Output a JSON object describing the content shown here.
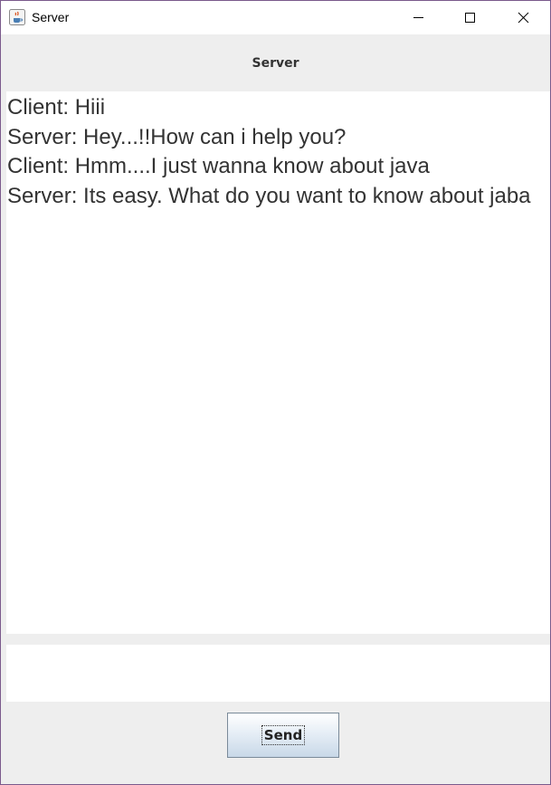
{
  "window": {
    "title": "Server",
    "icon": "java-cup-icon"
  },
  "header": {
    "title": "Server"
  },
  "chat": {
    "messages": [
      "Client: Hiii",
      "Server: Hey...!!How can i help you?",
      "Client: Hmm....I just wanna know about java",
      "Server: Its easy. What do you want to know about jaba"
    ]
  },
  "input": {
    "value": "",
    "placeholder": ""
  },
  "send_button": {
    "label": "Send"
  },
  "colors": {
    "window_border": "#7a5a8c",
    "panel_background": "#eeeeee",
    "text_area_background": "#ffffff",
    "chat_text": "#333333"
  }
}
